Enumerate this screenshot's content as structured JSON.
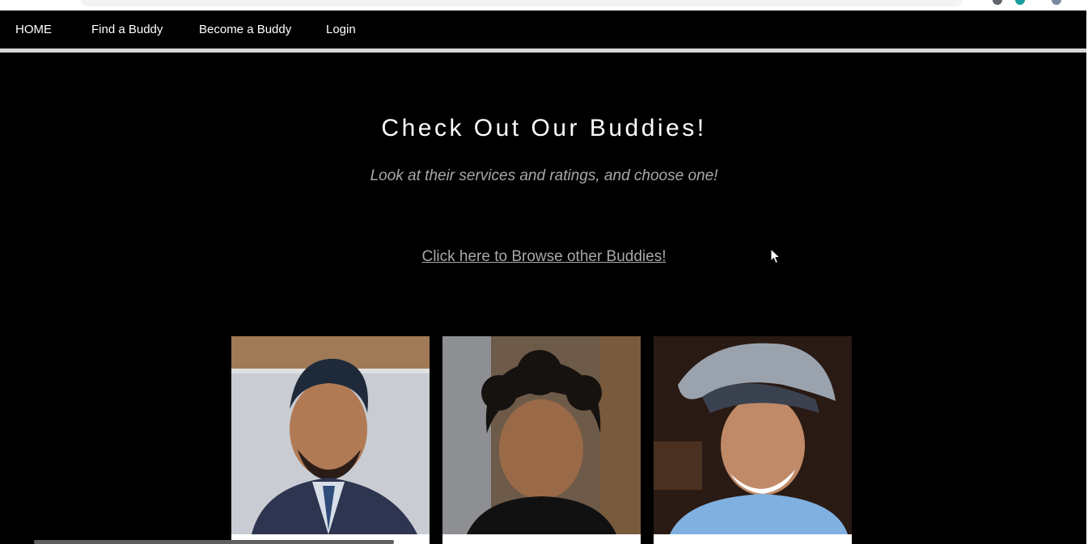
{
  "nav": {
    "items": [
      {
        "label": "HOME"
      },
      {
        "label": "Find a Buddy"
      },
      {
        "label": "Become a Buddy"
      },
      {
        "label": "Login"
      }
    ]
  },
  "hero": {
    "title": "Check Out Our Buddies!",
    "subtitle": "Look at their services and ratings, and choose one!",
    "browse_link": "Click here to Browse other Buddies!"
  },
  "buddies": [
    {
      "photo": "buddy-photo-man-in-suit"
    },
    {
      "photo": "buddy-photo-curly-hair-selfie"
    },
    {
      "photo": "buddy-photo-man-in-cap"
    }
  ],
  "colors": {
    "background": "#000000",
    "nav_text": "#ffffff",
    "title_text": "#ffffff",
    "muted_text": "#a8a8a8",
    "divider": "#d6d6d6"
  },
  "icons": {
    "cursor": "mouse-pointer-icon"
  }
}
